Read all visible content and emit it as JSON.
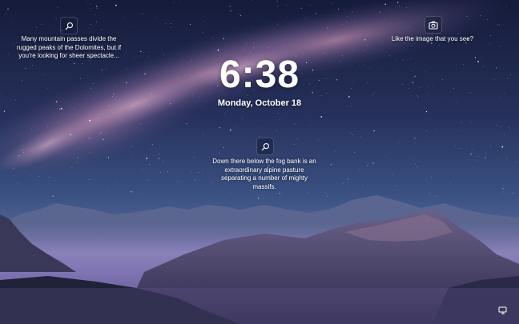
{
  "lock_screen": {
    "time": "6:38",
    "date": "Monday, October 18"
  },
  "spotlight": {
    "top_left": {
      "icon": "search-icon",
      "text": "Many mountain passes divide the rugged peaks of the Dolomites, but if you're looking for sheer spectacle..."
    },
    "center": {
      "icon": "search-icon",
      "text": "Down there below the fog bank is an extraordinary alpine pasture separating a number of mighty massifs."
    },
    "top_right": {
      "icon": "camera-icon",
      "text": "Like the image that you see?"
    }
  },
  "status": {
    "icon": "network-icon"
  }
}
